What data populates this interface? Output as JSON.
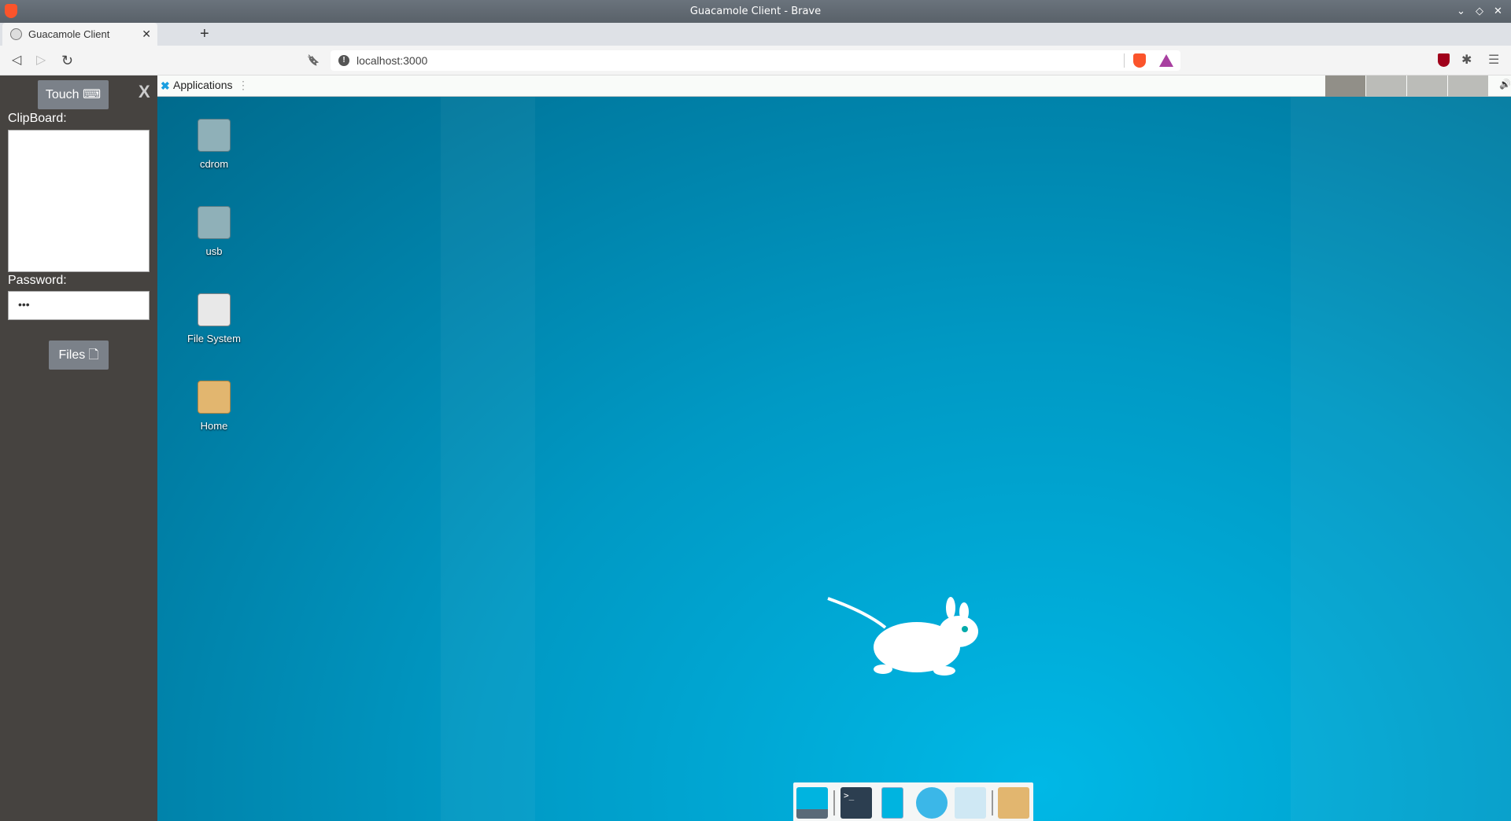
{
  "window": {
    "title": "Guacamole Client - Brave",
    "controls": [
      "⌄",
      "◇",
      "✕"
    ]
  },
  "tab": {
    "label": "Guacamole Client",
    "close": "✕",
    "new_tab": "+"
  },
  "nav": {
    "back": "◁",
    "forward": "▷",
    "reload": "↻",
    "bookmark": "🔖",
    "url": "localhost:3000",
    "menu": "☰"
  },
  "sidebar": {
    "touch_label": "Touch ⌨",
    "close_label": "X",
    "clipboard_label": "ClipBoard:",
    "clipboard_value": "",
    "password_label": "Password:",
    "password_value": "•••",
    "files_label": "Files 🗋"
  },
  "panel": {
    "applications_label": "Applications",
    "menu_glyph": "⋮",
    "volume": "🔊",
    "workspaces": [
      {
        "active": true
      },
      {
        "active": false
      },
      {
        "active": false
      },
      {
        "active": false
      }
    ]
  },
  "desktop": {
    "icons": [
      {
        "label": "cdrom",
        "icon": "cdrom-icon"
      },
      {
        "label": "usb",
        "icon": "usb-drive-icon"
      },
      {
        "label": "File System",
        "icon": "drive-icon"
      },
      {
        "label": "Home",
        "icon": "home-folder-icon"
      }
    ]
  },
  "dock": {
    "items": [
      "show-desktop-icon",
      "terminal-icon",
      "file-manager-icon",
      "web-browser-icon",
      "app-finder-icon",
      "folder-icon"
    ]
  }
}
